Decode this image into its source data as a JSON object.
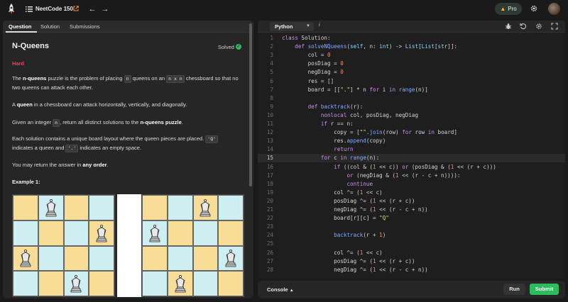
{
  "topbar": {
    "title": "NeetCode 150",
    "pro_label": "Pro"
  },
  "tabs": [
    {
      "label": "Question"
    },
    {
      "label": "Solution"
    },
    {
      "label": "Submissions"
    }
  ],
  "problem": {
    "title": "N-Queens",
    "status": "Solved",
    "difficulty": "Hard",
    "p1_a": "The ",
    "p1_b": "n-queens",
    "p1_c": " puzzle is the problem of placing ",
    "p1_code1": "n",
    "p1_d": " queens on an ",
    "p1_code2": "n x n",
    "p1_e": " chessboard so that no two queens can attack each other.",
    "p2_a": "A ",
    "p2_b": "queen",
    "p2_c": " in a chessboard can attack horizontally, vertically, and diagonally.",
    "p3_a": "Given an integer ",
    "p3_code": "n",
    "p3_b": ", return all distinct solutions to the ",
    "p3_c": "n-queens puzzle",
    "p3_d": ".",
    "p4_a": "Each solution contains a unique board layout where the queen pieces are placed. ",
    "p4_code1": "'Q'",
    "p4_b": " indicates a queen and ",
    "p4_code2": "'.'",
    "p4_c": " indicates an empty space.",
    "p5_a": "You may return the answer in ",
    "p5_b": "any order",
    "p5_c": ".",
    "example_title": "Example 1:"
  },
  "boards": [
    {
      "queens": [
        [
          0,
          1
        ],
        [
          1,
          3
        ],
        [
          2,
          0
        ],
        [
          3,
          2
        ]
      ]
    },
    {
      "queens": [
        [
          0,
          2
        ],
        [
          1,
          0
        ],
        [
          2,
          3
        ],
        [
          3,
          1
        ]
      ]
    }
  ],
  "colors": {
    "light": "#f7dd96",
    "dark": "#cdeff1",
    "accent_green": "#2cbb5d",
    "hard_red": "#ff375f"
  },
  "editor": {
    "language": "Python",
    "current_line": 15,
    "lines": [
      "class Solution:",
      "    def solveNQueens(self, n: int) -> List[List[str]]:",
      "        col = 0",
      "        posDiag = 0",
      "        negDiag = 0",
      "        res = []",
      "        board = [[\".\"] * n for i in range(n)]",
      "",
      "        def backtrack(r):",
      "            nonlocal col, posDiag, negDiag",
      "            if r == n:",
      "                copy = [\"\".join(row) for row in board]",
      "                res.append(copy)",
      "                return",
      "            for c in range(n):",
      "                if ((col & (1 << c)) or (posDiag & (1 << (r + c)))",
      "                    or (negDiag & (1 << (r - c + n)))):",
      "                    continue",
      "                col ^= (1 << c)",
      "                posDiag ^= (1 << (r + c))",
      "                negDiag ^= (1 << (r - c + n))",
      "                board[r][c] = \"Q\"",
      "",
      "                backtrack(r + 1)",
      "",
      "                col ^= (1 << c)",
      "                posDiag ^= (1 << (r + c))",
      "                negDiag ^= (1 << (r - c + n))"
    ]
  },
  "console": {
    "label": "Console",
    "run_label": "Run",
    "submit_label": "Submit"
  }
}
